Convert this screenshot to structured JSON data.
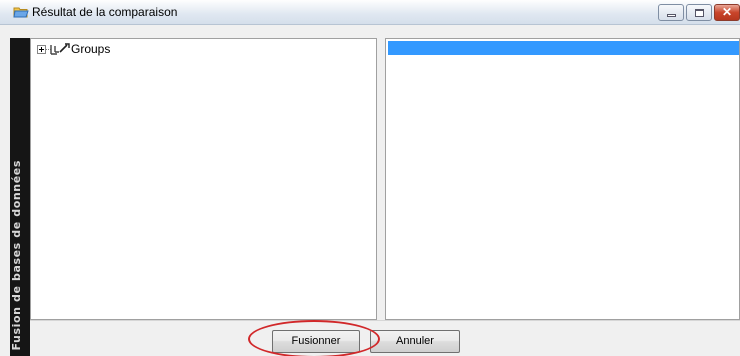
{
  "window": {
    "title": "Résultat de la comparaison",
    "icon": "folder-compare-icon",
    "controls": {
      "minimize": "minimize-icon",
      "maximize": "maximize-icon",
      "close": "close-icon",
      "close_glyph": "✕"
    }
  },
  "sidebar": {
    "label": "Fusion de bases de données",
    "color": "#151515"
  },
  "tree": {
    "nodes": [
      {
        "label": "Groups",
        "icon": "group-icon",
        "expander": "expand-plus-icon"
      }
    ]
  },
  "right_pane": {
    "selected_row_color": "#3399ff"
  },
  "footer": {
    "merge_label": "Fusionner",
    "cancel_label": "Annuler",
    "annotation_color": "#d1282a"
  }
}
